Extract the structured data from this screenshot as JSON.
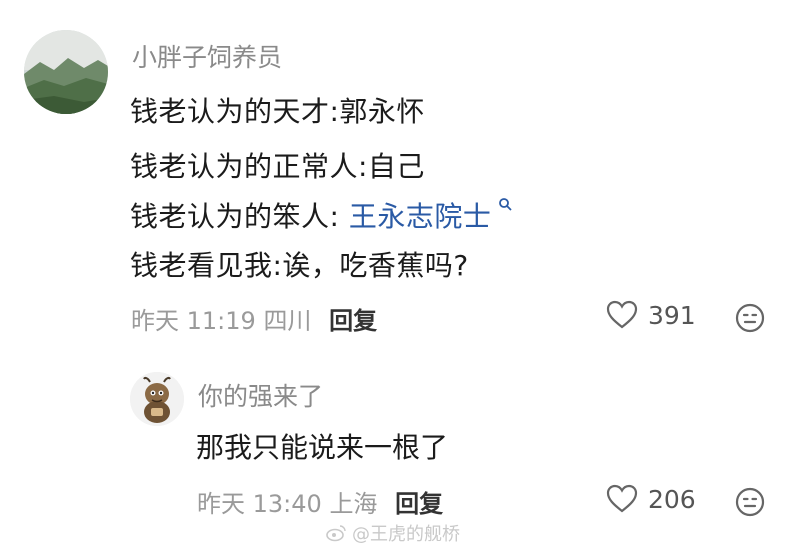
{
  "main_comment": {
    "username": "小胖子饲养员",
    "lines": [
      "钱老认为的天才:郭永怀",
      "钱老认为的正常人:自己",
      "钱老认为的笨人: ",
      "钱老看见我:诶，吃香蕉吗?"
    ],
    "link_text": "王永志院士",
    "date": "昨天 11:19",
    "location": "四川",
    "reply_label": "回复",
    "likes": "391",
    "avatar_icon": "landscape-avatar",
    "like_icon": "heart-icon",
    "emoji_icon": "emoji-face-icon"
  },
  "reply_comment": {
    "username": "你的强来了",
    "text": "那我只能说来一根了",
    "date": "昨天 13:40",
    "location": "上海",
    "reply_label": "回复",
    "likes": "206",
    "avatar_icon": "cartoon-character-avatar"
  },
  "watermark": {
    "text": "@王虎的舰桥",
    "icon": "weibo-logo-icon"
  },
  "colors": {
    "meta_gray": "#9a9a9a",
    "link_blue": "#2a5aa5",
    "text_dark": "#1b1b1b"
  }
}
